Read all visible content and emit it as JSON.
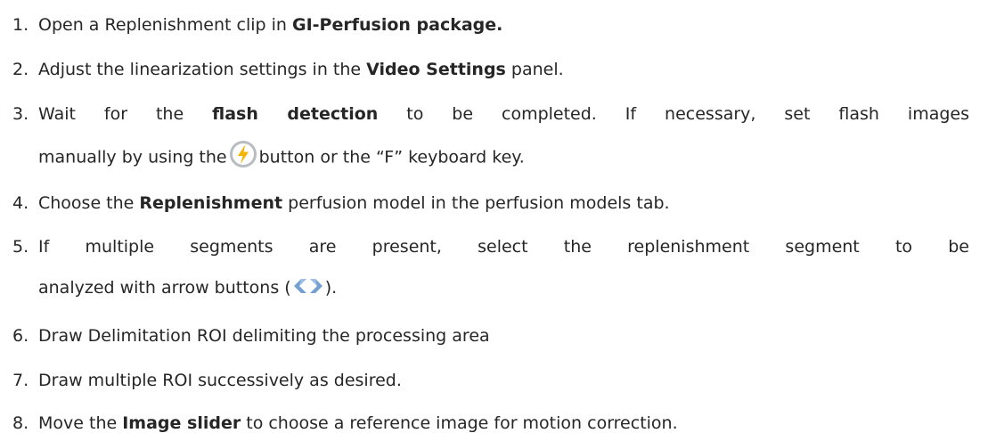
{
  "steps": [
    {
      "number": "1.",
      "before": "Open a Replenishment clip in ",
      "bold": "GI-Perfusion package."
    },
    {
      "number": "2.",
      "before": "Adjust the linearization settings in the ",
      "bold": "Video Settings",
      "after": " panel."
    },
    {
      "number": "3.",
      "before": "Wait for the ",
      "bold": "flash detection",
      "after": " to be completed. If necessary, set flash images",
      "line2_before": "manually by using the",
      "icon": "flash-icon",
      "line2_after": "button or the “F” keyboard key."
    },
    {
      "number": "4.",
      "before": "Choose the ",
      "bold": "Replenishment",
      "after": " perfusion model in the perfusion models tab."
    },
    {
      "number": "5.",
      "text": "If multiple segments are present, select the replenishment segment to be",
      "line2_before": "analyzed with arrow buttons (",
      "icon": "arrow-buttons-icon",
      "line2_after": ")."
    },
    {
      "number": "6.",
      "text": "Draw Delimitation ROI delimiting the processing area"
    },
    {
      "number": "7.",
      "text": "Draw multiple ROI successively as desired."
    },
    {
      "number": "8.",
      "before": "Move the ",
      "bold": "Image slider",
      "after": " to choose a reference image for motion correction."
    }
  ],
  "colors": {
    "text": "#262626",
    "flash_ring": "#b9bcc0",
    "flash_bolt": "#f5b400",
    "arrow": "#5b8fc9"
  }
}
